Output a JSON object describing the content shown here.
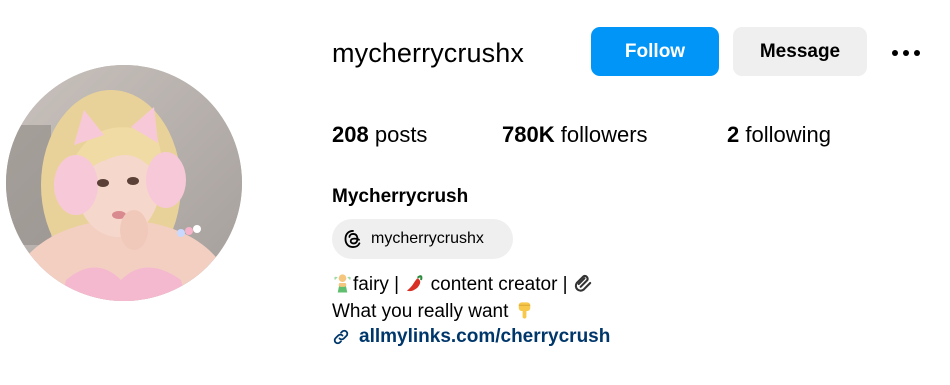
{
  "profile": {
    "username": "mycherrycrushx",
    "full_name": "Mycherrycrush",
    "follow_label": "Follow",
    "message_label": "Message",
    "more_icon": "more-horizontal-icon"
  },
  "stats": {
    "posts_count": "208",
    "posts_label": "posts",
    "followers_count": "780K",
    "followers_label": "followers",
    "following_count": "2",
    "following_label": "following"
  },
  "threads": {
    "handle": "mycherrycrushx",
    "icon": "threads-icon"
  },
  "bio": {
    "line1_part1": "fairy | ",
    "line1_part2": " content creator | ",
    "line2": "What you really want ",
    "emoji": [
      "fairy-emoji",
      "hot-pepper-emoji",
      "paperclip-emoji",
      "pointing-down-emoji"
    ]
  },
  "link": {
    "text": "allmylinks.com/cherrycrush",
    "icon": "link-icon"
  },
  "colors": {
    "accent": "#0095f6",
    "button_secondary": "#efefef",
    "link": "#00376b"
  }
}
